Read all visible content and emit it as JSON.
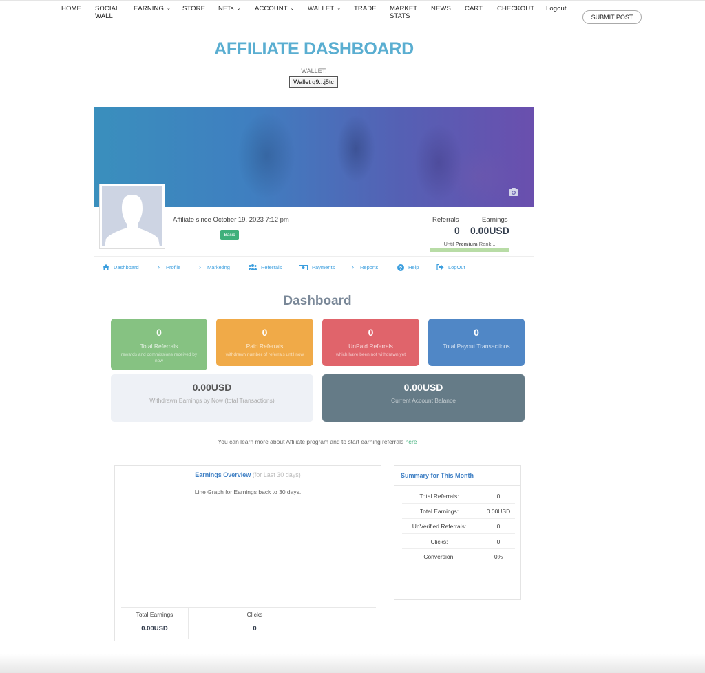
{
  "nav": {
    "items": [
      {
        "label": "HOME",
        "dropdown": false
      },
      {
        "label": "SOCIAL WALL",
        "dropdown": false
      },
      {
        "label": "EARNING",
        "dropdown": true
      },
      {
        "label": "STORE",
        "dropdown": false
      },
      {
        "label": "NFTs",
        "dropdown": true
      },
      {
        "label": "ACCOUNT",
        "dropdown": true
      },
      {
        "label": "WALLET",
        "dropdown": true
      },
      {
        "label": "TRADE",
        "dropdown": false
      },
      {
        "label": "MARKET STATS",
        "dropdown": false
      },
      {
        "label": "NEWS",
        "dropdown": false
      },
      {
        "label": "CART",
        "dropdown": false
      },
      {
        "label": "CHECKOUT",
        "dropdown": false
      },
      {
        "label": "Logout",
        "dropdown": false
      }
    ],
    "submit_post": "SUBMIT POST"
  },
  "header": {
    "title": "AFFILIATE DASHBOARD",
    "wallet_label": "WALLET:",
    "wallet_button": "Wallet q9...j5tc"
  },
  "profile": {
    "since": "Affiliate since October 19, 2023 7:12 pm",
    "rank_badge": "Basic",
    "badge_color": "#3fb07b",
    "referrals_label": "Referrals",
    "referrals_value": "0",
    "earnings_label": "Earnings",
    "earnings_value": "0.00USD",
    "rank_progress_prefix": "Until ",
    "rank_progress_rank": "Premium",
    "rank_progress_suffix": " Rank...",
    "rank_progress_fraction": 1.0
  },
  "subnav": [
    {
      "label": "Dashboard",
      "icon": "home-icon"
    },
    {
      "label": "Profile",
      "icon": "chevron-right-icon"
    },
    {
      "label": "Marketing",
      "icon": "chevron-right-icon"
    },
    {
      "label": "Referrals",
      "icon": "users-icon"
    },
    {
      "label": "Payments",
      "icon": "money-icon"
    },
    {
      "label": "Reports",
      "icon": "chevron-right-icon"
    },
    {
      "label": "Help",
      "icon": "question-circle-icon"
    },
    {
      "label": "LogOut",
      "icon": "sign-out-icon"
    }
  ],
  "dashboard": {
    "title": "Dashboard",
    "cards": [
      {
        "value": "0",
        "label": "Total Referrals",
        "sub": "rewards and commissions received by now",
        "color": "#86c282"
      },
      {
        "value": "0",
        "label": "Paid Referrals",
        "sub": "withdrawn number of referrals until now",
        "color": "#f0aa48"
      },
      {
        "value": "0",
        "label": "UnPaid Referrals",
        "sub": "which have been not withdrawn yet",
        "color": "#e0646b"
      },
      {
        "value": "0",
        "label": "Total Payout Transactions",
        "sub": "",
        "color": "#5087c6"
      }
    ],
    "withdrawn": {
      "value": "0.00USD",
      "label": "Withdrawn Earnings by Now (total Transactions)"
    },
    "balance": {
      "value": "0.00USD",
      "label": "Current Account Balance"
    },
    "learn_text": "You can learn more about Affiliate program and to start earning referrals ",
    "learn_link": "here"
  },
  "earnings_overview": {
    "title": "Earnings Overview",
    "title_sub": " (for Last 30 days)",
    "description": "Line Graph for Earnings back to 30 days.",
    "footer": [
      {
        "label": "Total Earnings",
        "value": "0.00USD"
      },
      {
        "label": "Clicks",
        "value": "0"
      }
    ]
  },
  "summary": {
    "title": "Summary for This Month",
    "rows": [
      {
        "key": "Total Referrals:",
        "value": "0"
      },
      {
        "key": "Total Earnings:",
        "value": "0.00USD"
      },
      {
        "key": "UnVerified Referrals:",
        "value": "0"
      },
      {
        "key": "Clicks:",
        "value": "0"
      },
      {
        "key": "Conversion:",
        "value": "0%"
      }
    ]
  }
}
